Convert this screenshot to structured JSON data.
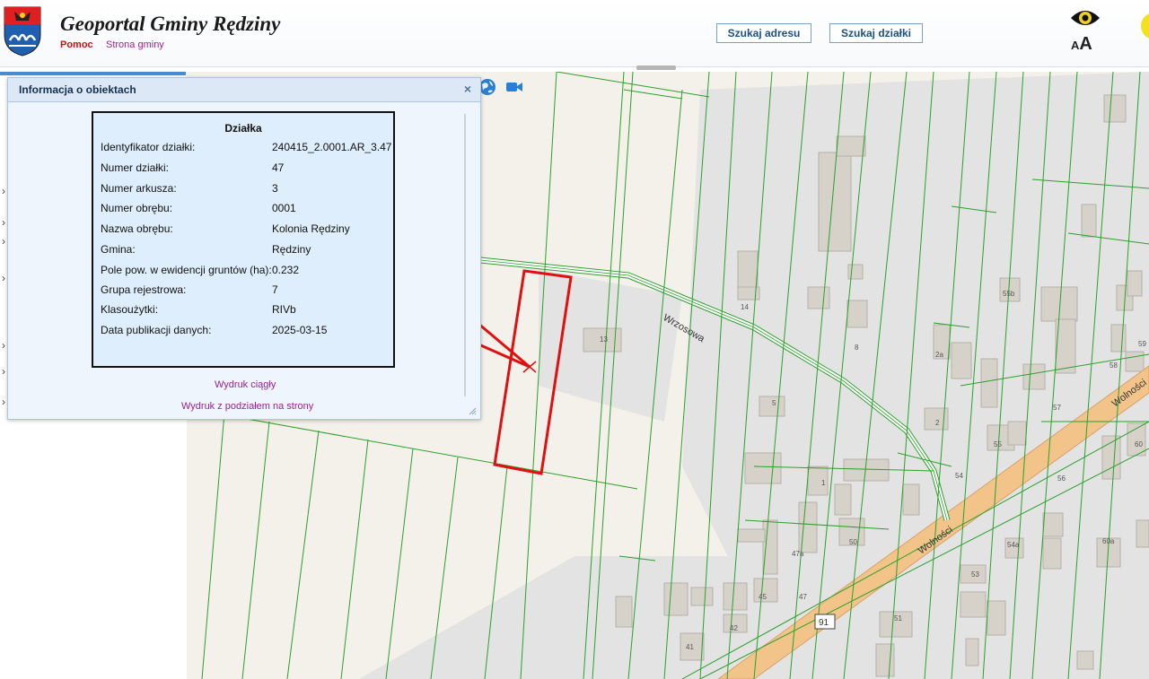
{
  "header": {
    "title": "Geoportal Gminy Rędziny",
    "links": {
      "help": "Pomoc",
      "municipality_page": "Strona gminy"
    },
    "buttons": {
      "search_address": "Szukaj adresu",
      "search_plot": "Szukaj działki"
    },
    "font_size_large": "A",
    "font_size_small": "A",
    "icons": [
      "coat-of-arms-logo",
      "accessibility-eye-icon",
      "font-size-icon"
    ]
  },
  "map_toolbar": {
    "icons": [
      "globe-icon",
      "video-camera-icon"
    ]
  },
  "info_panel": {
    "title": "Informacja o obiektach",
    "close_label": "×",
    "record": {
      "heading": "Działka",
      "rows": [
        {
          "label": "Identyfikator działki:",
          "value": "240415_2.0001.AR_3.47"
        },
        {
          "label": "Numer działki:",
          "value": "47"
        },
        {
          "label": "Numer arkusza:",
          "value": "3"
        },
        {
          "label": "Numer obrębu:",
          "value": "0001"
        },
        {
          "label": "Nazwa obrębu:",
          "value": "Kolonia Rędziny"
        },
        {
          "label": "Gmina:",
          "value": "Rędziny"
        },
        {
          "label": "Pole pow. w ewidencji gruntów (ha):",
          "value": "0.232"
        },
        {
          "label": "Grupa rejestrowa:",
          "value": "7"
        },
        {
          "label": "Klasoużytki:",
          "value": "RIVb"
        },
        {
          "label": "Data publikacji danych:",
          "value": "2025-03-15"
        }
      ]
    },
    "print_links": {
      "continuous": "Wydruk ciągły",
      "paged": "Wydruk z podziałem na strony"
    }
  },
  "map": {
    "streets": [
      "Wrzosowa",
      "Wolności",
      "Wolności"
    ],
    "road_number": "91",
    "building_numbers": [
      "13",
      "14",
      "8",
      "5",
      "1",
      "2",
      "2a",
      "47a",
      "47",
      "45",
      "42",
      "41",
      "50",
      "51",
      "53",
      "54",
      "54a",
      "55",
      "55b",
      "57",
      "58",
      "59",
      "60",
      "60a",
      "56"
    ],
    "colors": {
      "parcel_lines": "#2aa12a",
      "highlight": "#e01010",
      "road": "#f2c48a",
      "buildings": "#d6d2c9"
    }
  },
  "colors": {
    "panel_bg": "#eef5fc",
    "accent_link": "#9a1e96",
    "help_link": "#d01010"
  }
}
